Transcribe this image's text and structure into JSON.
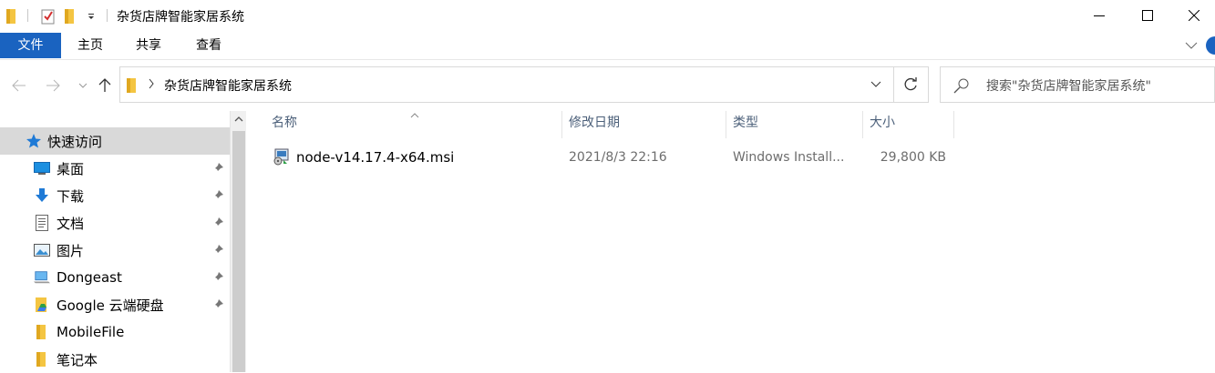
{
  "window": {
    "title": "杂货店牌智能家居系统"
  },
  "ribbon": {
    "tabs": [
      "文件",
      "主页",
      "共享",
      "查看"
    ],
    "active_color": "#1a63c0"
  },
  "address": {
    "path": "杂货店牌智能家居系统"
  },
  "search": {
    "placeholder": "搜索\"杂货店牌智能家居系统\""
  },
  "sidebar": {
    "items": [
      {
        "label": "快速访问",
        "icon": "star-icon",
        "pinned": false,
        "selected": true
      },
      {
        "label": "桌面",
        "icon": "desktop-icon",
        "pinned": true
      },
      {
        "label": "下载",
        "icon": "download-icon",
        "pinned": true
      },
      {
        "label": "文档",
        "icon": "document-icon",
        "pinned": true
      },
      {
        "label": "图片",
        "icon": "pictures-icon",
        "pinned": true
      },
      {
        "label": "Dongeast",
        "icon": "computer-icon",
        "pinned": true
      },
      {
        "label": "Google 云端硬盘",
        "icon": "google-drive-icon",
        "pinned": true
      },
      {
        "label": "MobileFile",
        "icon": "folder-icon",
        "pinned": false
      },
      {
        "label": "笔记本",
        "icon": "folder-icon",
        "pinned": false
      }
    ]
  },
  "columns": {
    "name": "名称",
    "date": "修改日期",
    "type": "类型",
    "size": "大小"
  },
  "files": [
    {
      "name": "node-v14.17.4-x64.msi",
      "date": "2021/8/3 22:16",
      "type": "Windows Install...",
      "size": "29,800 KB",
      "icon": "msi-installer-icon"
    }
  ]
}
